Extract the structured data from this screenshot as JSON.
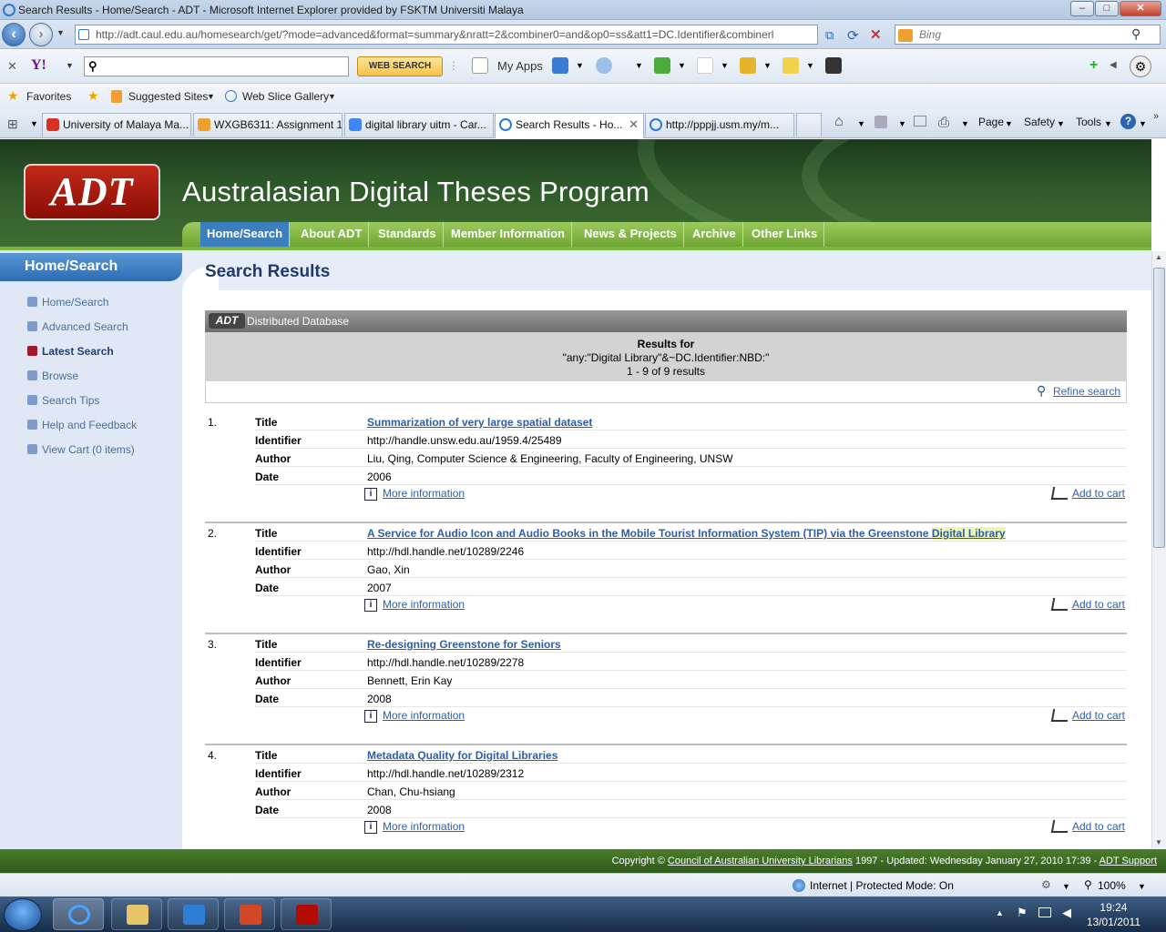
{
  "window": {
    "title": "Search Results - Home/Search - ADT - Microsoft Internet Explorer provided by FSKTM Universiti Malaya",
    "address": "http://adt.caul.edu.au/homesearch/get/?mode=advanced&format=summary&nratt=2&combiner0=and&op0=ss&att1=DC.Identifier&combinerl",
    "search_placeholder": "Bing"
  },
  "yahoo_bar": {
    "search_button": "WEB SEARCH",
    "my_apps": "My Apps"
  },
  "favorites_bar": {
    "favorites": "Favorites",
    "suggested": "Suggested Sites",
    "webslice": "Web Slice Gallery"
  },
  "tabs": [
    {
      "label": "University of Malaya Ma...",
      "color": "#d93025"
    },
    {
      "label": "WXGB6311: Assignment 1",
      "color": "#f0a030"
    },
    {
      "label": "digital library uitm - Car...",
      "color": "#4285f4"
    },
    {
      "label": "Search Results - Ho...",
      "color": "#2b79d0"
    },
    {
      "label": "http://pppjj.usm.my/m...",
      "color": "#2b79d0"
    }
  ],
  "commands": {
    "page": "Page",
    "safety": "Safety",
    "tools": "Tools"
  },
  "site": {
    "logo": "ADT",
    "title": "Australasian Digital Theses Program",
    "nav": [
      "Home/Search",
      "About ADT",
      "Standards",
      "Member Information",
      "News & Projects",
      "Archive",
      "Other Links"
    ],
    "sidebar_heading": "Home/Search",
    "sidebar": [
      "Home/Search",
      "Advanced Search",
      "Latest Search",
      "Browse",
      "Search Tips",
      "Help and Feedback",
      "View Cart (0 items)"
    ],
    "page_title": "Search Results",
    "db_logo": "ADT",
    "db_title": "Distributed Database",
    "results_for_label": "Results for",
    "query": "\"any:\"Digital Library\"&~DC.Identifier:NBD:\"",
    "count": "1 - 9 of 9 results",
    "refine": "Refine search"
  },
  "labels": {
    "title": "Title",
    "identifier": "Identifier",
    "author": "Author",
    "date": "Date",
    "more": "More information",
    "cart": "Add to cart"
  },
  "results": [
    {
      "num": "1.",
      "title": "Summarization of very large spatial dataset",
      "identifier": "http://handle.unsw.edu.au/1959.4/25489",
      "author": "Liu, Qing, Computer Science & Engineering, Faculty of Engineering, UNSW",
      "date": "2006"
    },
    {
      "num": "2.",
      "title": "A Service for Audio Icon and Audio Books in the Mobile Tourist Information System (TIP) via the Greenstone",
      "title_highlight": "Digital Library",
      "identifier": "http://hdl.handle.net/10289/2246",
      "author": "Gao, Xin",
      "date": "2007"
    },
    {
      "num": "3.",
      "title": "Re-designing Greenstone for Seniors",
      "identifier": "http://hdl.handle.net/10289/2278",
      "author": "Bennett, Erin Kay",
      "date": "2008"
    },
    {
      "num": "4.",
      "title": "Metadata Quality for Digital Libraries",
      "identifier": "http://hdl.handle.net/10289/2312",
      "author": "Chan, Chu-hsiang",
      "date": "2008"
    }
  ],
  "footer": {
    "prefix": "Copyright ©",
    "org": "Council of Australian University Librarians",
    "suffix": "1997 - Updated: Wednesday January 27, 2010 17:39 -",
    "support": "ADT Support"
  },
  "statusbar": {
    "zone": "Internet | Protected Mode: On",
    "zoom": "100%"
  },
  "taskbar": {
    "time": "19:24",
    "date": "13/01/2011"
  }
}
